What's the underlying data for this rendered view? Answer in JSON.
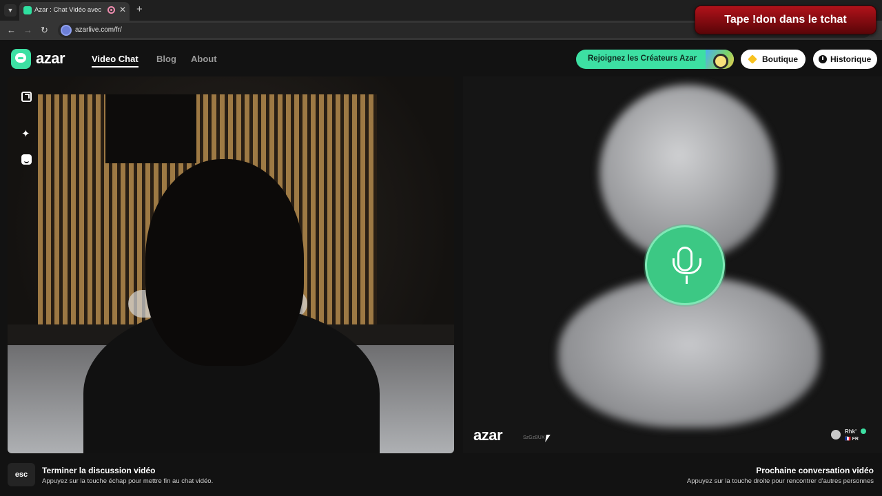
{
  "browser": {
    "tab_title": "Azar : Chat Vidéo avec de n",
    "tab_close": "✕",
    "new_tab": "+",
    "url": "azarlive.com/fr/",
    "nav": {
      "back": "←",
      "forward": "→",
      "reload": "↻"
    }
  },
  "overlay": {
    "banner_text": "Tape !don dans le tchat"
  },
  "header": {
    "logo_text": "azar",
    "nav_items": [
      "Video Chat",
      "Blog",
      "About"
    ],
    "creators_label": "Rejoignez les Créateurs Azar",
    "shop_label": "Boutique",
    "history_label": "Historique"
  },
  "local_video": {
    "tools": [
      "expand-icon",
      "sparkle-icon",
      "face-filter-icon"
    ]
  },
  "remote_video": {
    "logo_text": "azar",
    "handle": "SzGzBUX",
    "peer_name": "Rhk'",
    "peer_country": "🇫🇷 FR"
  },
  "footer": {
    "esc_key": "esc",
    "end_title": "Terminer la discussion vidéo",
    "end_sub": "Appuyez sur la touche échap pour mettre fin au chat vidéo.",
    "next_title": "Prochaine conversation vidéo",
    "next_sub": "Appuyez sur la touche droite pour rencontrer d'autres personnes"
  },
  "colors": {
    "brand_green": "#3de0a3",
    "banner_red": "#b0121a",
    "mic_green": "#3cc884"
  }
}
